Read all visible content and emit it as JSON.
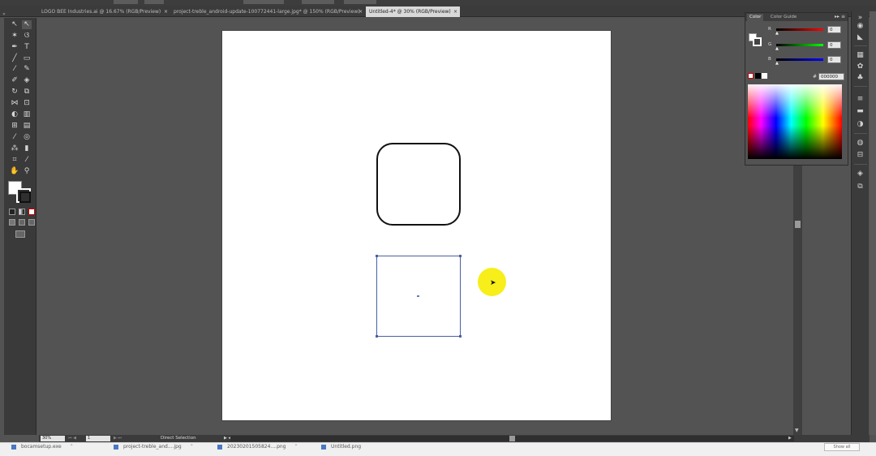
{
  "tabs": [
    {
      "label": "LOGO BEE Industries.ai @ 16.67% (RGB/Preview)",
      "close": "×"
    },
    {
      "label": "project-treble_android-update-100772441-large.jpg* @ 150% (RGB/Preview)",
      "close": "×"
    },
    {
      "label": "Untitled-4* @ 30% (RGB/Preview)",
      "close": "×",
      "active": true
    }
  ],
  "tools": {
    "icons": [
      "selection-icon",
      "direct-selection-icon",
      "magic-wand-icon",
      "lasso-icon",
      "pen-icon",
      "type-icon",
      "line-icon",
      "rectangle-icon",
      "paintbrush-icon",
      "pencil-icon",
      "blob-brush-icon",
      "eraser-icon",
      "rotate-icon",
      "scale-icon",
      "width-icon",
      "free-transform-icon",
      "shape-builder-icon",
      "perspective-grid-icon",
      "mesh-icon",
      "gradient-icon",
      "eyedropper-icon",
      "blend-icon",
      "symbol-sprayer-icon",
      "column-graph-icon",
      "artboard-icon",
      "slice-icon",
      "hand-icon",
      "zoom-icon"
    ]
  },
  "color_panel": {
    "tabs": [
      "Color",
      "Color Guide"
    ],
    "menu": "▸▸ ≡",
    "channels": [
      {
        "label": "R",
        "value": "0",
        "color": "#ff0000"
      },
      {
        "label": "G",
        "value": "0",
        "color": "#00ff00"
      },
      {
        "label": "B",
        "value": "0",
        "color": "#0000ff"
      }
    ],
    "hash": "#",
    "hex": "000000"
  },
  "status": {
    "zoom": "30%",
    "page": "1",
    "tool": "Direct Selection"
  },
  "taskbar": [
    {
      "label": "bocamsetup.exe"
    },
    {
      "label": "project-treble_and....jpg"
    },
    {
      "label": "20230201505824....png"
    },
    {
      "label": "Untitled.png"
    }
  ],
  "taskbar_button": "Show all"
}
